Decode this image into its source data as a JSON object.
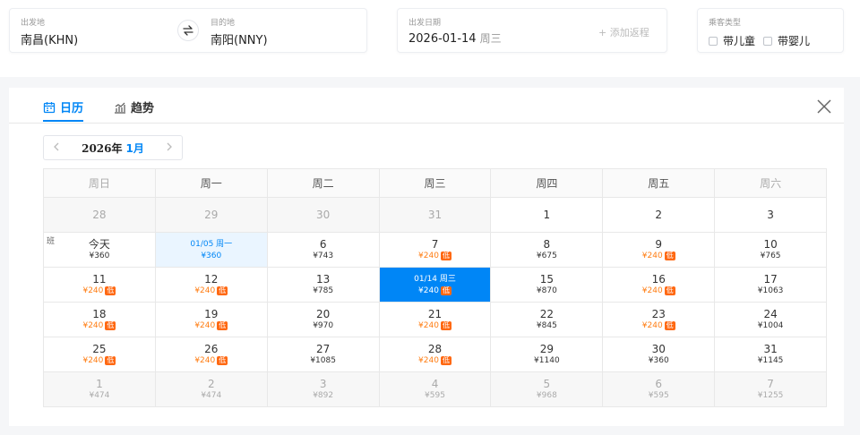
{
  "search": {
    "origin_label": "出发地",
    "origin_value": "南昌(KHN)",
    "dest_label": "目的地",
    "dest_value": "南阳(NNY)",
    "date_label": "出发日期",
    "date_value": "2026-01-14",
    "date_weekday": "周三",
    "add_return": "+ 添加返程",
    "ptype_label": "乘客类型",
    "ptype_child": "带儿童",
    "ptype_infant": "带婴儿"
  },
  "calendar": {
    "tab_calendar": "日历",
    "tab_trend": "趋势",
    "year_label": "2026年",
    "month_label": "1月",
    "weekdays": [
      "周日",
      "周一",
      "周二",
      "周三",
      "周四",
      "周五",
      "周六"
    ],
    "low_tag": "低",
    "holiday_mark": "班",
    "rows": [
      [
        {
          "d": "28",
          "p": "",
          "other": true
        },
        {
          "d": "29",
          "p": "",
          "other": true
        },
        {
          "d": "30",
          "p": "",
          "other": true
        },
        {
          "d": "31",
          "p": "",
          "other": true
        },
        {
          "d": "1",
          "p": ""
        },
        {
          "d": "2",
          "p": ""
        },
        {
          "d": "3",
          "p": ""
        }
      ],
      [
        {
          "d": "今天",
          "p": "¥360",
          "today": true,
          "ban": true
        },
        {
          "d": "01/05 周一",
          "p": "¥360",
          "start": true
        },
        {
          "d": "6",
          "p": "¥743"
        },
        {
          "d": "7",
          "p": "¥240",
          "low": true
        },
        {
          "d": "8",
          "p": "¥675"
        },
        {
          "d": "9",
          "p": "¥240",
          "low": true
        },
        {
          "d": "10",
          "p": "¥765"
        }
      ],
      [
        {
          "d": "11",
          "p": "¥240",
          "low": true
        },
        {
          "d": "12",
          "p": "¥240",
          "low": true
        },
        {
          "d": "13",
          "p": "¥785"
        },
        {
          "d": "01/14 周三",
          "p": "¥240",
          "low": true,
          "sel": true
        },
        {
          "d": "15",
          "p": "¥870"
        },
        {
          "d": "16",
          "p": "¥240",
          "low": true
        },
        {
          "d": "17",
          "p": "¥1063"
        }
      ],
      [
        {
          "d": "18",
          "p": "¥240",
          "low": true
        },
        {
          "d": "19",
          "p": "¥240",
          "low": true
        },
        {
          "d": "20",
          "p": "¥970"
        },
        {
          "d": "21",
          "p": "¥240",
          "low": true
        },
        {
          "d": "22",
          "p": "¥845"
        },
        {
          "d": "23",
          "p": "¥240",
          "low": true
        },
        {
          "d": "24",
          "p": "¥1004"
        }
      ],
      [
        {
          "d": "25",
          "p": "¥240",
          "low": true
        },
        {
          "d": "26",
          "p": "¥240",
          "low": true
        },
        {
          "d": "27",
          "p": "¥1085"
        },
        {
          "d": "28",
          "p": "¥240",
          "low": true
        },
        {
          "d": "29",
          "p": "¥1140"
        },
        {
          "d": "30",
          "p": "¥360"
        },
        {
          "d": "31",
          "p": "¥1145"
        }
      ],
      [
        {
          "d": "1",
          "p": "¥474",
          "other": true
        },
        {
          "d": "2",
          "p": "¥474",
          "other": true
        },
        {
          "d": "3",
          "p": "¥892",
          "other": true
        },
        {
          "d": "4",
          "p": "¥595",
          "other": true
        },
        {
          "d": "5",
          "p": "¥968",
          "other": true
        },
        {
          "d": "6",
          "p": "¥595",
          "other": true
        },
        {
          "d": "7",
          "p": "¥1255",
          "other": true
        }
      ]
    ]
  },
  "colors": {
    "accent": "#0086f6",
    "low_price": "#ff7d13"
  }
}
